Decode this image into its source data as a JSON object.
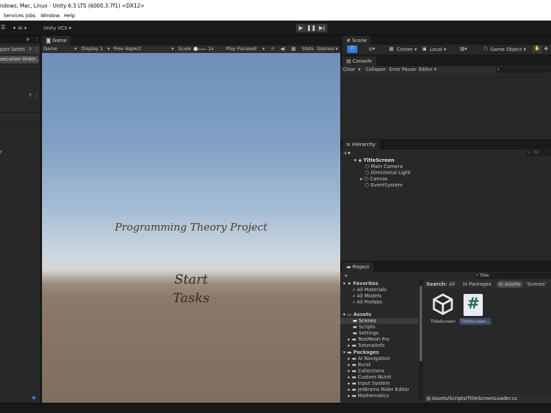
{
  "window": {
    "title": "ndows, Mac, Linux - Unity 6.3 LTS (6000.3.7f1) <DX12>"
  },
  "menu": [
    "Services",
    "Jobs",
    "Window",
    "Help"
  ],
  "toolbar": {
    "ai_label": "AI",
    "vcs_label": "Unity VCS"
  },
  "left_panel": {
    "header": "port Settin",
    "button": "xecution Order...",
    "partial_text": "r"
  },
  "game": {
    "tab": "Game",
    "toolbar": {
      "mode": "Game",
      "display": "Display 1",
      "aspect": "Free Aspect",
      "scale_label": "Scale",
      "scale_value": "1x",
      "play_focus": "Play Focused",
      "stats": "Stats",
      "gizmos": "Gizmos"
    },
    "scene_title": "Programming Theory Project",
    "button_line1": "Start",
    "button_line2": "Tasks"
  },
  "scene": {
    "tab": "Scene",
    "pivot": "Center",
    "space": "Local",
    "create": "Game Object"
  },
  "console": {
    "tab": "Console",
    "clear": "Clear",
    "collapse": "Collapse",
    "error_pause": "Error Pause",
    "editor": "Editor"
  },
  "hierarchy": {
    "tab": "Hierarchy",
    "search_placeholder": "All",
    "scene_name": "TitleScreen",
    "items": [
      "Main Camera",
      "Directional Light",
      "Canvas",
      "EventSystem"
    ]
  },
  "project": {
    "tab": "Project",
    "search_value": "Title",
    "favorites": {
      "label": "Favorites",
      "items": [
        "All Materials",
        "All Models",
        "All Prefabs"
      ]
    },
    "assets": {
      "label": "Assets",
      "items": [
        "Scenes",
        "Scripts",
        "Settings",
        "TextMesh Pro",
        "TutorialInfo"
      ]
    },
    "packages": {
      "label": "Packages",
      "items": [
        "AI Navigation",
        "Burst",
        "Collections",
        "Custom NUnit",
        "Input System",
        "JetBrains Rider Editor",
        "Mathematics"
      ]
    },
    "search_filter": {
      "label": "Search:",
      "all": "All",
      "in_packages": "In Packages",
      "in_assets": "In Assets",
      "scenes": "'Scenes'"
    },
    "results": [
      "TitleScreen",
      "TitleScreen..."
    ],
    "path": "Assets/Scripts/TitleScreenLoader.cs"
  },
  "colors": {
    "game_text": "#3b2c17",
    "selection": "#3c3c3c",
    "accent_blue": "#3a79d8"
  }
}
